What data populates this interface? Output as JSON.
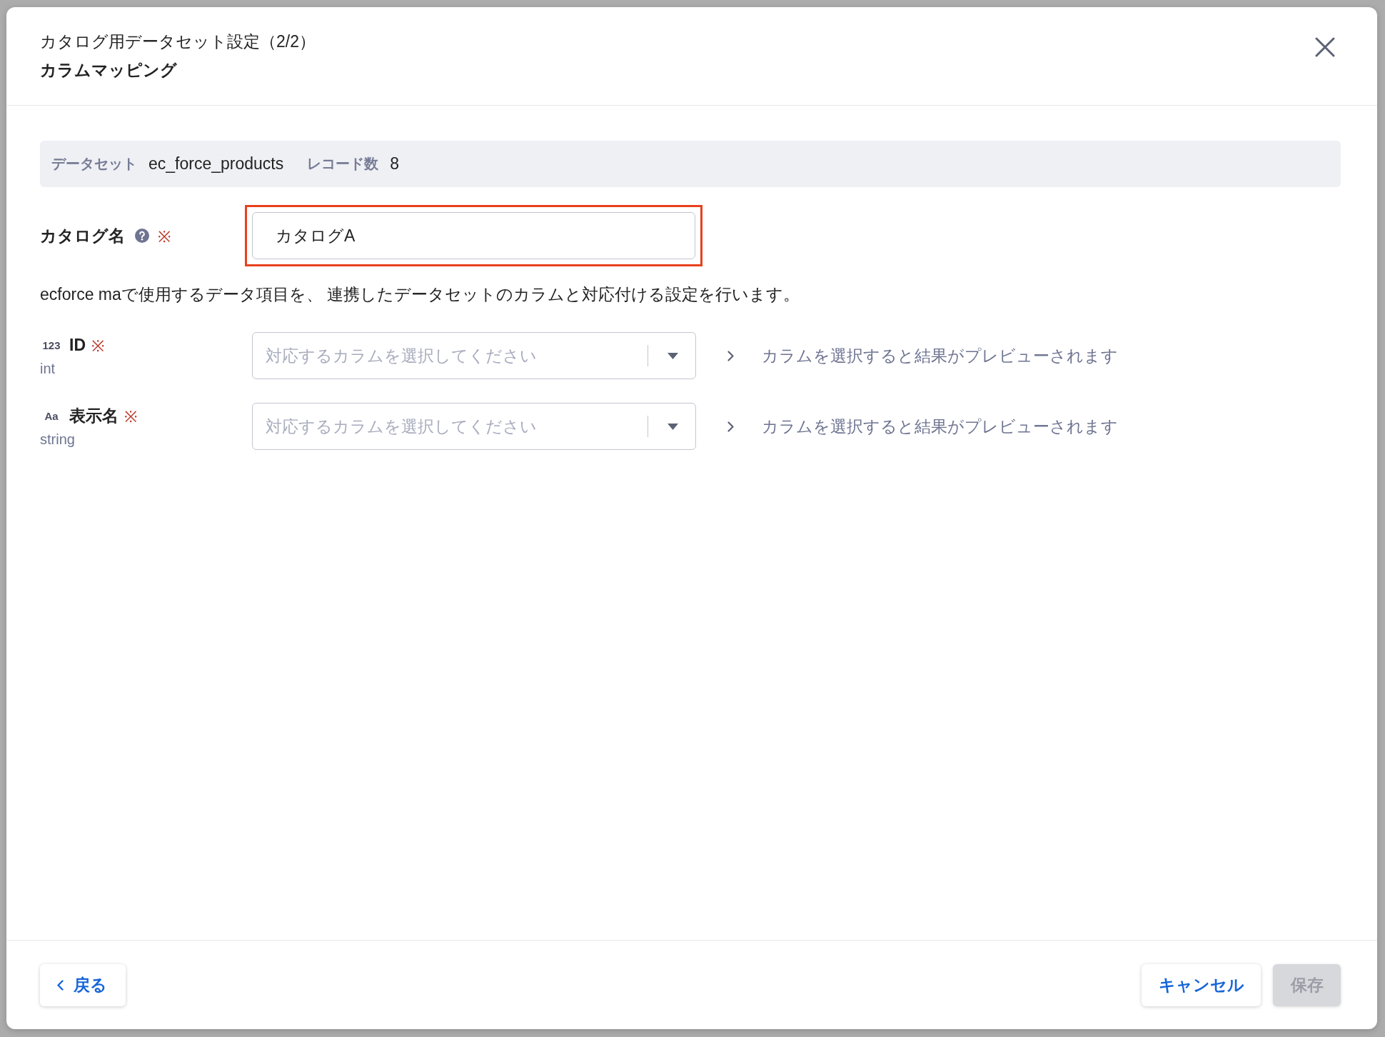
{
  "dialog": {
    "title": "カタログ用データセット設定（2/2）",
    "subtitle": "カラムマッピング"
  },
  "dataset_info": [
    {
      "label": "データセット",
      "value": "ec_force_products"
    },
    {
      "label": "レコード数",
      "value": "8"
    }
  ],
  "catalog_name": {
    "label": "カタログ名",
    "required_mark": "※",
    "value": "カタログA",
    "highlighted": true
  },
  "description": "ecforce maで使用するデータ項目を、 連携したデータセットのカラムと対応付ける設定を行います。",
  "mappings": [
    {
      "type_symbol": "123",
      "name": "ID",
      "required_mark": "※",
      "type": "int",
      "placeholder": "対応するカラムを選択してください",
      "preview": "カラムを選択すると結果がプレビューされます"
    },
    {
      "type_symbol": "Aa",
      "name": "表示名",
      "required_mark": "※",
      "type": "string",
      "placeholder": "対応するカラムを選択してください",
      "preview": "カラムを選択すると結果がプレビューされます"
    }
  ],
  "footer": {
    "back": "戻る",
    "cancel": "キャンセル",
    "save": {
      "label": "保存",
      "disabled": true
    }
  }
}
